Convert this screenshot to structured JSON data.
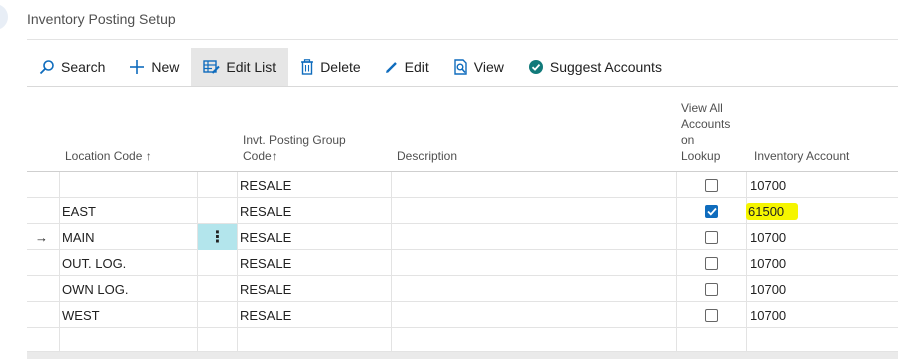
{
  "title": "Inventory Posting Setup",
  "toolbar": {
    "search": "Search",
    "new": "New",
    "edit_list": "Edit List",
    "delete": "Delete",
    "edit": "Edit",
    "view": "View",
    "suggest": "Suggest Accounts"
  },
  "columns": {
    "location_code": "Location Code",
    "group_code_line1": "Invt. Posting Group",
    "group_code_line2": "Code",
    "description": "Description",
    "view_all_1": "View All",
    "view_all_2": "Accounts",
    "view_all_3": "on",
    "view_all_4": "Lookup",
    "inventory_account": "Inventory Account",
    "sort_arrow": "↑"
  },
  "rows": [
    {
      "location": "",
      "group": "RESALE",
      "description": "",
      "view_all": false,
      "account": "10700"
    },
    {
      "location": "EAST",
      "group": "RESALE",
      "description": "",
      "view_all": true,
      "account": "61500"
    },
    {
      "location": "MAIN",
      "group": "RESALE",
      "description": "",
      "view_all": false,
      "account": "10700"
    },
    {
      "location": "OUT. LOG.",
      "group": "RESALE",
      "description": "",
      "view_all": false,
      "account": "10700"
    },
    {
      "location": "OWN LOG.",
      "group": "RESALE",
      "description": "",
      "view_all": false,
      "account": "10700"
    },
    {
      "location": "WEST",
      "group": "RESALE",
      "description": "",
      "view_all": false,
      "account": "10700"
    }
  ],
  "current_row_marker": "→",
  "row_menu_glyph": "⋮",
  "colors": {
    "accent": "#0f6cbd",
    "highlight": "#f5f500",
    "selected_cell": "#b3e5ec",
    "check_teal": "#117a7a"
  }
}
